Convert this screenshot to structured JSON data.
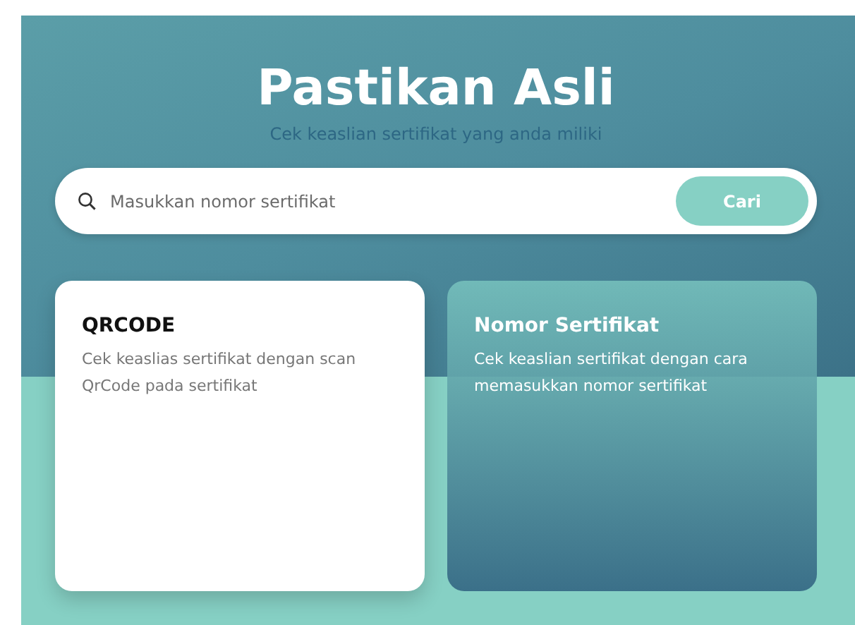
{
  "hero": {
    "title": "Pastikan Asli",
    "subtitle": "Cek keaslian sertifikat yang anda miliki"
  },
  "search": {
    "placeholder": "Masukkan nomor sertifikat",
    "button": "Cari"
  },
  "options": [
    {
      "title": "QRCODE",
      "description": "Cek keaslias sertifikat dengan scan QrCode pada sertifikat",
      "selected": true
    },
    {
      "title": "Nomor Sertifikat",
      "description": "Cek keaslian sertifikat dengan cara memasukkan nomor sertifikat",
      "selected": false
    }
  ]
}
